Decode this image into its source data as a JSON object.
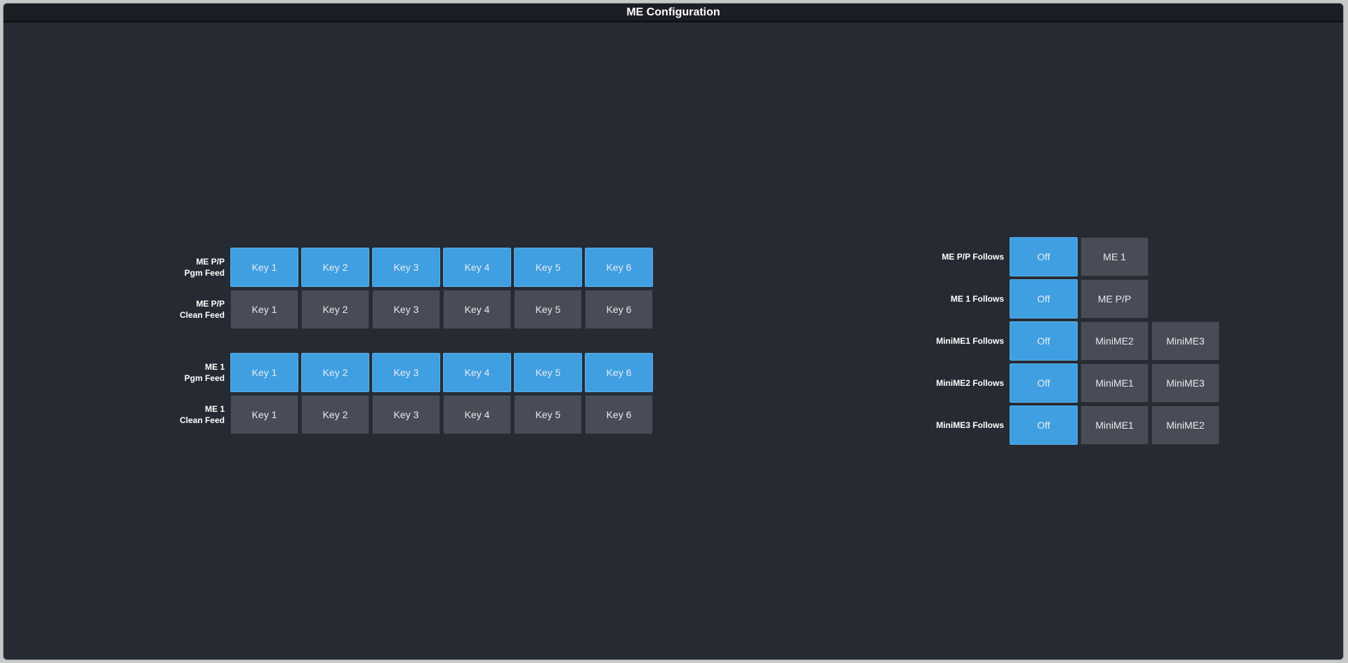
{
  "window": {
    "title": "ME Configuration"
  },
  "key_rows": [
    {
      "label_1": "ME P/P",
      "label_2": "Pgm Feed",
      "keys": [
        {
          "label": "Key 1",
          "active": true
        },
        {
          "label": "Key 2",
          "active": true
        },
        {
          "label": "Key 3",
          "active": true
        },
        {
          "label": "Key 4",
          "active": true
        },
        {
          "label": "Key 5",
          "active": true
        },
        {
          "label": "Key 6",
          "active": true
        }
      ]
    },
    {
      "label_1": "ME P/P",
      "label_2": "Clean Feed",
      "keys": [
        {
          "label": "Key 1",
          "active": false
        },
        {
          "label": "Key 2",
          "active": false
        },
        {
          "label": "Key 3",
          "active": false
        },
        {
          "label": "Key 4",
          "active": false
        },
        {
          "label": "Key 5",
          "active": false
        },
        {
          "label": "Key 6",
          "active": false
        }
      ]
    },
    {
      "label_1": "ME 1",
      "label_2": "Pgm Feed",
      "keys": [
        {
          "label": "Key 1",
          "active": true
        },
        {
          "label": "Key 2",
          "active": true
        },
        {
          "label": "Key 3",
          "active": true
        },
        {
          "label": "Key 4",
          "active": true
        },
        {
          "label": "Key 5",
          "active": true
        },
        {
          "label": "Key 6",
          "active": true
        }
      ]
    },
    {
      "label_1": "ME 1",
      "label_2": "Clean Feed",
      "keys": [
        {
          "label": "Key 1",
          "active": false
        },
        {
          "label": "Key 2",
          "active": false
        },
        {
          "label": "Key 3",
          "active": false
        },
        {
          "label": "Key 4",
          "active": false
        },
        {
          "label": "Key 5",
          "active": false
        },
        {
          "label": "Key 6",
          "active": false
        }
      ]
    }
  ],
  "follow_rows": [
    {
      "label": "ME P/P Follows",
      "options": [
        {
          "label": "Off",
          "active": true
        },
        {
          "label": "ME 1",
          "active": false
        }
      ]
    },
    {
      "label": "ME 1 Follows",
      "options": [
        {
          "label": "Off",
          "active": true
        },
        {
          "label": "ME P/P",
          "active": false
        }
      ]
    },
    {
      "label": "MiniME1 Follows",
      "options": [
        {
          "label": "Off",
          "active": true
        },
        {
          "label": "MiniME2",
          "active": false
        },
        {
          "label": "MiniME3",
          "active": false
        }
      ]
    },
    {
      "label": "MiniME2 Follows",
      "options": [
        {
          "label": "Off",
          "active": true
        },
        {
          "label": "MiniME1",
          "active": false
        },
        {
          "label": "MiniME3",
          "active": false
        }
      ]
    },
    {
      "label": "MiniME3 Follows",
      "options": [
        {
          "label": "Off",
          "active": true
        },
        {
          "label": "MiniME1",
          "active": false
        },
        {
          "label": "MiniME2",
          "active": false
        }
      ]
    }
  ],
  "colors": {
    "active": "#3f9fe0",
    "inactive": "#474c57",
    "background": "#262b33"
  }
}
